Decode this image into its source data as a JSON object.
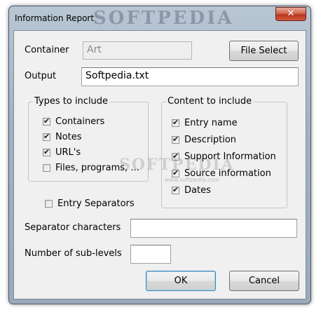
{
  "window": {
    "title": "Information Report",
    "close_glyph": "✕"
  },
  "container": {
    "label": "Container",
    "value": "Art",
    "file_select_label": "File Select"
  },
  "output": {
    "label": "Output",
    "value": "Softpedia.txt"
  },
  "types_group": {
    "title": "Types to include",
    "items": [
      {
        "label": "Containers",
        "checked": true
      },
      {
        "label": "Notes",
        "checked": true
      },
      {
        "label": "URL's",
        "checked": true
      },
      {
        "label": "Files, programs, ...",
        "checked": false
      }
    ]
  },
  "content_group": {
    "title": "Content to include",
    "items": [
      {
        "label": "Entry name",
        "checked": true
      },
      {
        "label": "Description",
        "checked": true
      },
      {
        "label": "Support Information",
        "checked": true
      },
      {
        "label": "Source information",
        "checked": true
      },
      {
        "label": "Dates",
        "checked": true
      }
    ]
  },
  "entry_separators": {
    "label": "Entry Separators",
    "checked": false
  },
  "separator_chars": {
    "label": "Separator characters",
    "value": ""
  },
  "sublevels": {
    "label": "Number of sub-levels",
    "value": ""
  },
  "buttons": {
    "ok": "OK",
    "cancel": "Cancel"
  },
  "icons": {
    "checkmark": "✔"
  },
  "watermark_text": "SOFTPEDIA",
  "watermark_url": "www.softpedia.com"
}
